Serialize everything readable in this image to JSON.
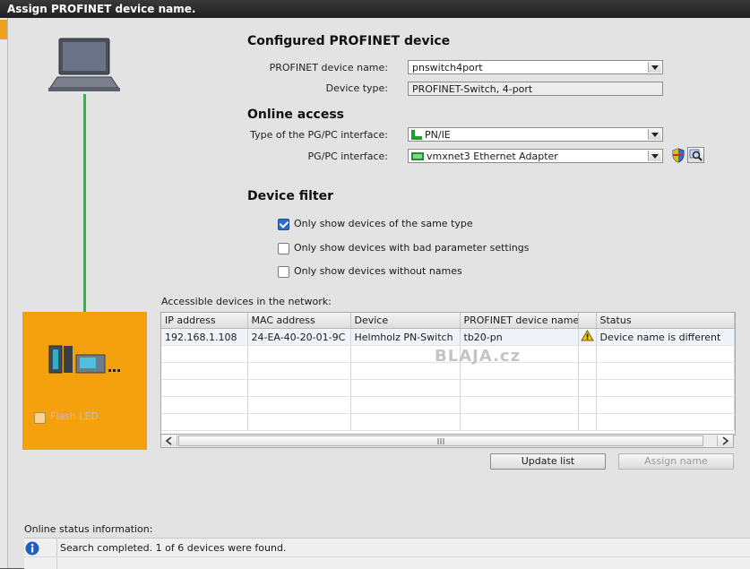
{
  "window": {
    "title": "Assign PROFINET device name."
  },
  "configured": {
    "heading": "Configured PROFINET device",
    "device_name_label": "PROFINET device name:",
    "device_name_value": "pnswitch4port",
    "device_type_label": "Device type:",
    "device_type_value": "PROFINET-Switch, 4-port"
  },
  "online": {
    "heading": "Online access",
    "iface_type_label": "Type of the PG/PC interface:",
    "iface_type_value": "PN/IE",
    "iface_label": "PG/PC interface:",
    "iface_value": "vmxnet3 Ethernet Adapter"
  },
  "filter": {
    "heading": "Device filter",
    "options": [
      {
        "label": "Only show devices of the same type",
        "checked": true
      },
      {
        "label": "Only show devices with bad parameter settings",
        "checked": false
      },
      {
        "label": "Only show devices without names",
        "checked": false
      }
    ]
  },
  "devices": {
    "label": "Accessible devices in the network:",
    "columns": [
      "IP address",
      "MAC address",
      "Device",
      "PROFINET device name",
      "",
      "Status"
    ],
    "rows": [
      {
        "ip": "192.168.1.108",
        "mac": "24-EA-40-20-01-9C",
        "device": "Helmholz PN-Switch",
        "pn_name": "tb20-pn",
        "status_icon": "warning-icon",
        "status": "Device name is different"
      }
    ],
    "watermark": "BLAJA.cz"
  },
  "buttons": {
    "update": "Update list",
    "assign": "Assign name"
  },
  "flash": {
    "label": "Flash LED",
    "checked": false
  },
  "status": {
    "label": "Online status information:",
    "message": "Search completed. 1 of 6 devices were found."
  },
  "colors": {
    "accent_orange": "#f5a00d",
    "link_green": "#22c03a",
    "checkbox_blue": "#2c6fc9"
  }
}
